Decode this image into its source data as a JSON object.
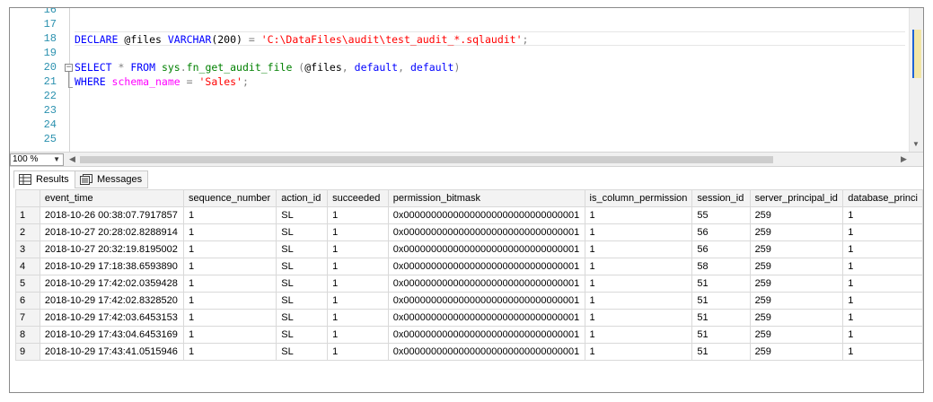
{
  "editor": {
    "line_numbers": [
      "16",
      "17",
      "18",
      "19",
      "20",
      "21",
      "22",
      "23",
      "24",
      "25"
    ],
    "lines": [
      {
        "parts": []
      },
      {
        "parts": []
      },
      {
        "parts": [
          {
            "t": "DECLARE ",
            "c": "kw"
          },
          {
            "t": "@files ",
            "c": ""
          },
          {
            "t": "VARCHAR",
            "c": "kw"
          },
          {
            "t": "(200) ",
            "c": ""
          },
          {
            "t": "= ",
            "c": "op"
          },
          {
            "t": "'C:\\DataFiles\\audit\\test_audit_*.sqlaudit'",
            "c": "str"
          },
          {
            "t": ";",
            "c": "op"
          }
        ]
      },
      {
        "parts": []
      },
      {
        "parts": [
          {
            "t": "SELECT ",
            "c": "kw"
          },
          {
            "t": "* ",
            "c": "op"
          },
          {
            "t": "FROM ",
            "c": "kw"
          },
          {
            "t": "sys",
            "c": "sysobj"
          },
          {
            "t": ".",
            "c": "op"
          },
          {
            "t": "fn_get_audit_file ",
            "c": "sysobj"
          },
          {
            "t": "(",
            "c": "op"
          },
          {
            "t": "@files",
            "c": ""
          },
          {
            "t": ", ",
            "c": "op"
          },
          {
            "t": "default",
            "c": "kw"
          },
          {
            "t": ", ",
            "c": "op"
          },
          {
            "t": "default",
            "c": "kw"
          },
          {
            "t": ")",
            "c": "op"
          }
        ]
      },
      {
        "parts": [
          {
            "t": "WHERE ",
            "c": "kw"
          },
          {
            "t": "schema_name ",
            "c": "col"
          },
          {
            "t": "= ",
            "c": "op"
          },
          {
            "t": "'Sales'",
            "c": "str"
          },
          {
            "t": ";",
            "c": "op"
          }
        ]
      },
      {
        "parts": []
      },
      {
        "parts": []
      },
      {
        "parts": []
      },
      {
        "parts": []
      }
    ]
  },
  "zoom": {
    "value": "100 %"
  },
  "tabs": {
    "results_label": "Results",
    "messages_label": "Messages"
  },
  "grid": {
    "columns": [
      "event_time",
      "sequence_number",
      "action_id",
      "succeeded",
      "permission_bitmask",
      "is_column_permission",
      "session_id",
      "server_principal_id",
      "database_princi"
    ],
    "rows": [
      [
        "1",
        "2018-10-26 00:38:07.7917857",
        "1",
        "SL",
        "1",
        "0x00000000000000000000000000000001",
        "1",
        "55",
        "259",
        "1"
      ],
      [
        "2",
        "2018-10-27 20:28:02.8288914",
        "1",
        "SL",
        "1",
        "0x00000000000000000000000000000001",
        "1",
        "56",
        "259",
        "1"
      ],
      [
        "3",
        "2018-10-27 20:32:19.8195002",
        "1",
        "SL",
        "1",
        "0x00000000000000000000000000000001",
        "1",
        "56",
        "259",
        "1"
      ],
      [
        "4",
        "2018-10-29 17:18:38.6593890",
        "1",
        "SL",
        "1",
        "0x00000000000000000000000000000001",
        "1",
        "58",
        "259",
        "1"
      ],
      [
        "5",
        "2018-10-29 17:42:02.0359428",
        "1",
        "SL",
        "1",
        "0x00000000000000000000000000000001",
        "1",
        "51",
        "259",
        "1"
      ],
      [
        "6",
        "2018-10-29 17:42:02.8328520",
        "1",
        "SL",
        "1",
        "0x00000000000000000000000000000001",
        "1",
        "51",
        "259",
        "1"
      ],
      [
        "7",
        "2018-10-29 17:42:03.6453153",
        "1",
        "SL",
        "1",
        "0x00000000000000000000000000000001",
        "1",
        "51",
        "259",
        "1"
      ],
      [
        "8",
        "2018-10-29 17:43:04.6453169",
        "1",
        "SL",
        "1",
        "0x00000000000000000000000000000001",
        "1",
        "51",
        "259",
        "1"
      ],
      [
        "9",
        "2018-10-29 17:43:41.0515946",
        "1",
        "SL",
        "1",
        "0x00000000000000000000000000000001",
        "1",
        "51",
        "259",
        "1"
      ]
    ]
  },
  "colors": {
    "keyword": "#0000ff",
    "string": "#ff0000",
    "system": "#008000",
    "column": "#ff00ff",
    "line_number": "#2b91af"
  }
}
